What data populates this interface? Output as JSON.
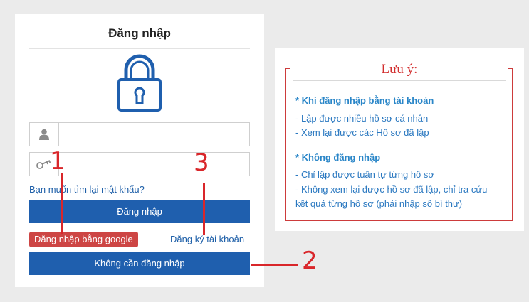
{
  "login": {
    "title": "Đăng nhập",
    "username_placeholder": "",
    "password_placeholder": "",
    "forgot_password": "Bạn muốn tìm lại mật khẩu?",
    "login_button": "Đăng nhập",
    "google_button": "Đăng nhập bằng google",
    "register_link": "Đăng ký tài khoản",
    "no_login_button": "Không cần đăng nhập"
  },
  "notes": {
    "title": "Lưu ý:",
    "section1_heading": "* Khi đăng nhập bằng tài khoản",
    "section1_lines": [
      "- Lập được nhiều hồ sơ cá nhân",
      "- Xem lại được các Hồ sơ đã lập"
    ],
    "section2_heading": "* Không đăng nhập",
    "section2_lines": [
      "- Chỉ lập được tuần tự từng hồ sơ",
      "- Không xem lại được hồ sơ đã lập, chỉ tra cứu",
      "kết quả từng hồ sơ (phải nhập số bì thư)"
    ]
  },
  "annotations": [
    "1",
    "2",
    "3"
  ],
  "colors": {
    "primary": "#1f5fae",
    "google": "#cd4544",
    "note_accent": "#d22e2e",
    "note_text": "#2a78c0",
    "annotation": "#d9262a"
  },
  "icons": [
    "lock-icon",
    "user-icon",
    "key-icon"
  ]
}
